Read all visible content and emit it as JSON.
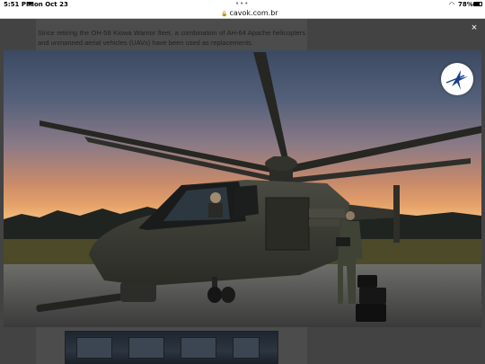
{
  "status_bar": {
    "time": "5:51 PM",
    "date": "Mon Oct 23",
    "battery": "78%"
  },
  "address_bar": {
    "url": "cavok.com.br"
  },
  "article": {
    "text": "Since retiring the OH-58 Kiowa Warrior fleet, a combination of AH-64 Apache helicopters and unmanned aerial vehicles (UAVs) have been used as replacements."
  },
  "lightbox": {
    "close_label": "×",
    "logo_icon": "lockheed-martin-logo-icon",
    "image_icon": "helicopter-photo"
  },
  "colors": {
    "sky_top": "#3b4a62",
    "sunset": "#e6a26a",
    "helicopter": "#3a3b33"
  }
}
